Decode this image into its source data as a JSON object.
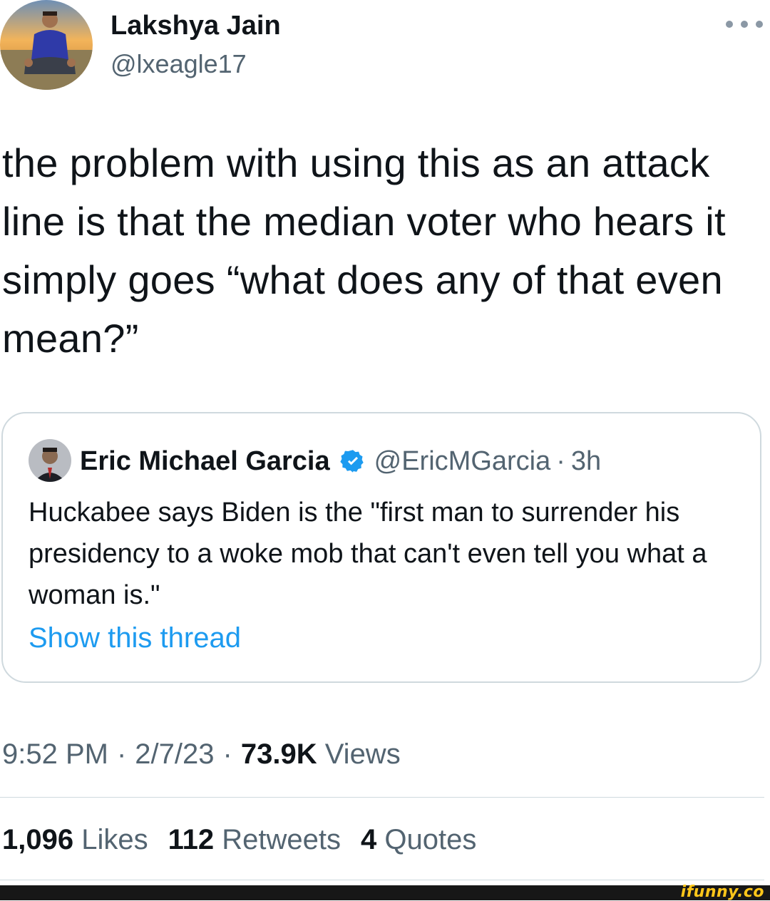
{
  "author": {
    "name": "Lakshya Jain",
    "handle": "@lxeagle17"
  },
  "tweet": {
    "text": "the problem with using this as an attack line is that the median voter who hears it simply goes “what does any of that even mean?”"
  },
  "quoted_tweet": {
    "name": "Eric Michael Garcia",
    "verified": true,
    "handle": "@EricMGarcia",
    "separator": "·",
    "age": "3h",
    "text": "Huckabee says Biden is the \"first man to surrender his presidency to a woke mob that can't even tell you what a woman is.\"",
    "show_thread_label": "Show this thread"
  },
  "meta": {
    "time": "9:52 PM",
    "separator": "·",
    "date": "2/7/23",
    "views_count": "73.9K",
    "views_label": "Views"
  },
  "stats": {
    "likes_count": "1,096",
    "likes_label": "Likes",
    "retweets_count": "112",
    "retweets_label": "Retweets",
    "quotes_count": "4",
    "quotes_label": "Quotes"
  },
  "icons": {
    "more": "more-horizontal-icon",
    "verified": "verified-badge-icon"
  },
  "colors": {
    "text": "#0f1419",
    "secondary": "#536471",
    "link": "#1d9bf0",
    "border": "#cfd9de",
    "watermark": "#ffc61a"
  },
  "watermark": {
    "text": "ifunny.co"
  }
}
